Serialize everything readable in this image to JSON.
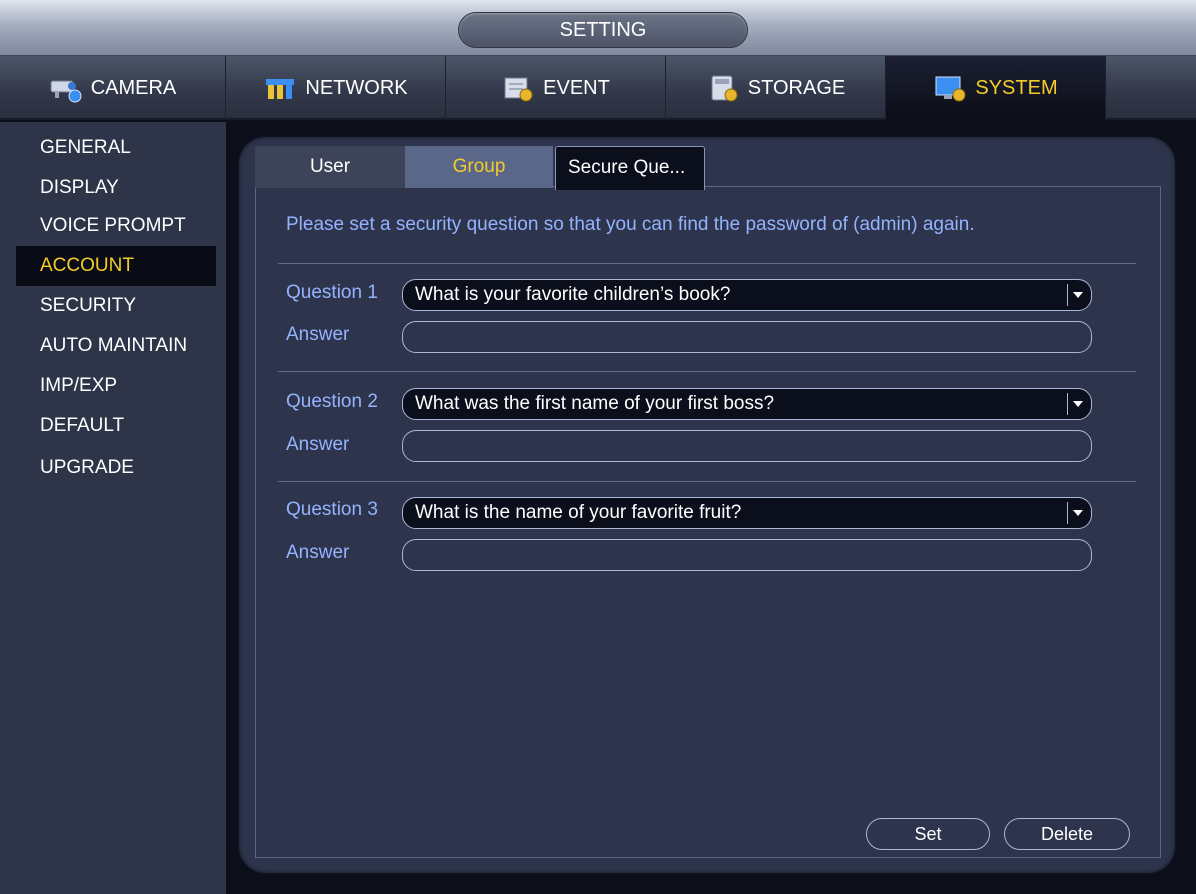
{
  "window": {
    "title": "SETTING"
  },
  "top_nav": [
    {
      "label": "CAMERA",
      "icon": "camera-icon",
      "active": false
    },
    {
      "label": "NETWORK",
      "icon": "network-icon",
      "active": false
    },
    {
      "label": "EVENT",
      "icon": "event-icon",
      "active": false
    },
    {
      "label": "STORAGE",
      "icon": "storage-icon",
      "active": false
    },
    {
      "label": "SYSTEM",
      "icon": "system-icon",
      "active": true
    }
  ],
  "sidebar": {
    "items": [
      {
        "label": "GENERAL",
        "active": false
      },
      {
        "label": "DISPLAY",
        "active": false
      },
      {
        "label": "VOICE PROMPT",
        "active": false
      },
      {
        "label": "ACCOUNT",
        "active": true
      },
      {
        "label": "SECURITY",
        "active": false
      },
      {
        "label": "AUTO MAINTAIN",
        "active": false
      },
      {
        "label": "IMP/EXP",
        "active": false
      },
      {
        "label": "DEFAULT",
        "active": false
      },
      {
        "label": "UPGRADE",
        "active": false
      }
    ]
  },
  "tabs": {
    "user": "User",
    "group": "Group",
    "secure": "Secure Que..."
  },
  "notice": "Please set a security question so that you can find the password of (admin) again.",
  "questions": [
    {
      "label": "Question 1",
      "value": "What is your favorite children’s book?",
      "answer_label": "Answer",
      "answer": ""
    },
    {
      "label": "Question 2",
      "value": "What was the first name of your first boss?",
      "answer_label": "Answer",
      "answer": ""
    },
    {
      "label": "Question 3",
      "value": "What is the name of your favorite fruit?",
      "answer_label": "Answer",
      "answer": ""
    }
  ],
  "buttons": {
    "set": "Set",
    "delete": "Delete"
  },
  "colors": {
    "accent_active": "#f4cc29",
    "label_blue": "#94b3ff",
    "panel_bg": "#2d344b",
    "sidebar_bg": "#2f3549"
  }
}
